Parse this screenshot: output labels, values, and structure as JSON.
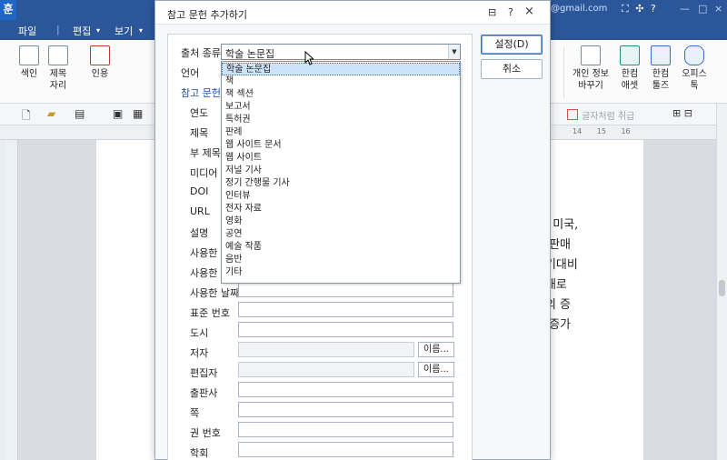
{
  "app": {
    "logo": "훈",
    "email_fragment": "@gmail.com",
    "title_icons": "⛶ ✣ ?",
    "win_min": "—",
    "win_max": "□",
    "win_close": "×"
  },
  "menu": [
    "파일",
    "편집",
    "보기"
  ],
  "ribbon": {
    "left": [
      {
        "label1": "색인",
        "label2": ""
      },
      {
        "label1": "제목",
        "label2": "자리"
      },
      {
        "label1": "인용",
        "label2": ""
      }
    ],
    "right": [
      {
        "label1": "개인 정보",
        "label2": "바꾸기"
      },
      {
        "label1": "한컴",
        "label2": "애셋"
      },
      {
        "label1": "한컴",
        "label2": "툴즈"
      },
      {
        "label1": "오피스",
        "label2": "톡"
      }
    ]
  },
  "toolbar2": {
    "hint": "글자처럼 취급"
  },
  "ruler_numbers": "14 15 16",
  "document_lines": [
    "국, 미국,",
    "로 판매",
    "분기대비",
    "반대로",
    "액의 증",
    "은 증가"
  ],
  "dialog": {
    "title": "참고 문헌 추가하기",
    "tools": {
      "memo": "⊟",
      "help": "?",
      "close": "×"
    },
    "source_type_label": "출처 종류",
    "source_type_value": "학술 논문집",
    "language_label": "언어",
    "section_label": "참고 문헌",
    "dropdown_options": [
      "학술 논문집",
      "책",
      "책 섹션",
      "보고서",
      "특허권",
      "판례",
      "웹 사이트 문서",
      "웹 사이트",
      "저널 기사",
      "정기 간행물 기사",
      "인터뷰",
      "전자 자료",
      "영화",
      "공연",
      "예술 작품",
      "음반",
      "기타"
    ],
    "fields_hidden": [
      "연도",
      "제목",
      "부 제목",
      "미디어",
      "DOI",
      "URL",
      "설명",
      "사용한 연",
      "사용한 월",
      "사용한 날짜"
    ],
    "fields_visible": [
      "표준 번호",
      "도시"
    ],
    "author_label": "저자",
    "editor_label": "편집자",
    "name_button": "이름...",
    "fields_bottom": [
      "출판사",
      "쪽",
      "권 번호",
      "학회"
    ],
    "ok_button": "설정(D)",
    "cancel_button": "취소"
  }
}
